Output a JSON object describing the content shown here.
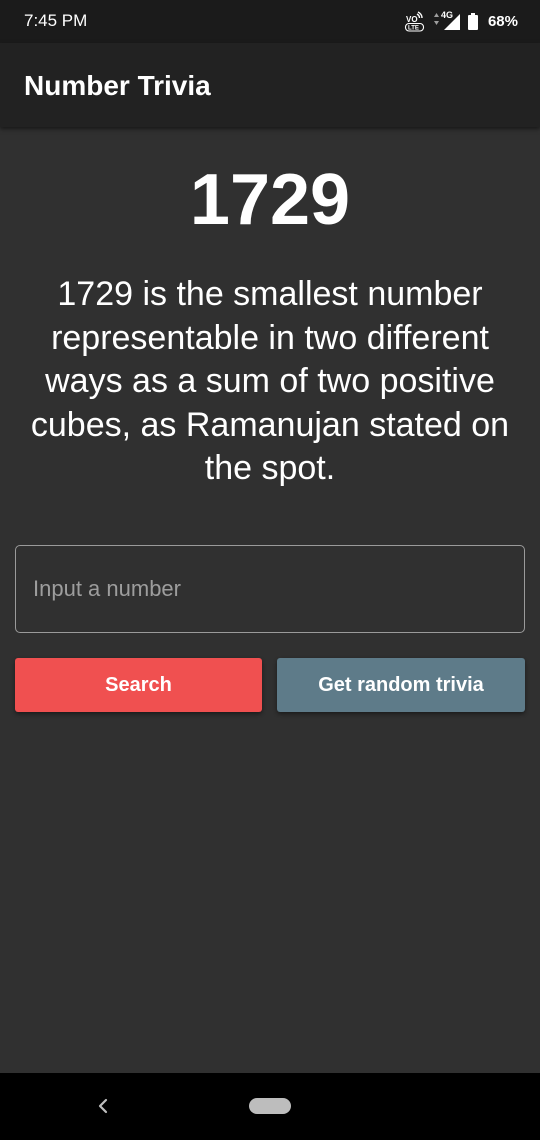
{
  "status_bar": {
    "time": "7:45 PM",
    "network_label": "4G",
    "battery": "68%",
    "icons": [
      "volte-icon",
      "signal-icon",
      "battery-icon"
    ]
  },
  "app_bar": {
    "title": "Number Trivia"
  },
  "trivia": {
    "number": "1729",
    "text": "1729 is the smallest number representable in two different ways as a sum of two positive cubes, as Ramanujan stated on the spot."
  },
  "input": {
    "placeholder": "Input a number",
    "value": ""
  },
  "buttons": {
    "search_label": "Search",
    "random_label": "Get random trivia"
  },
  "colors": {
    "background": "#303030",
    "app_bar": "#222222",
    "search_button": "#f05050",
    "random_button": "#5e7b89"
  },
  "nav_bar": {
    "icons": [
      "back-icon",
      "home-pill-icon"
    ]
  }
}
